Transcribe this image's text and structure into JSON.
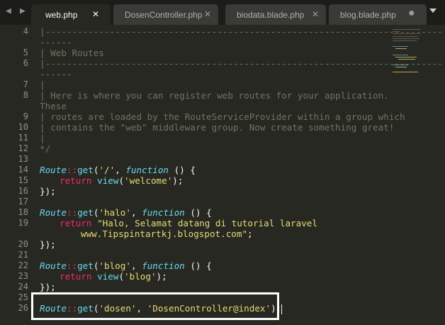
{
  "tabs": [
    {
      "label": "web.php",
      "close": "✕",
      "active": true
    },
    {
      "label": "DosenController.php",
      "close": "✕",
      "active": false
    },
    {
      "label": "biodata.blade.php",
      "close": "✕",
      "active": false
    },
    {
      "label": "blog.blade.php",
      "close": "●",
      "active": false
    }
  ],
  "nav": {
    "left": "◀",
    "right": "▶"
  },
  "line_numbers": [
    "4",
    "",
    "5",
    "6",
    "",
    "7",
    "8",
    "",
    "9",
    "10",
    "11",
    "12",
    "13",
    "14",
    "15",
    "16",
    "17",
    "18",
    "19",
    "",
    "20",
    "21",
    "22",
    "23",
    "24",
    "25",
    "26"
  ],
  "code": {
    "l4": "|--------------------------------------------------------------------------",
    "l4b": "------",
    "l5": "| Web Routes",
    "l6": "|--------------------------------------------------------------------------",
    "l6b": "------",
    "l7": "|",
    "l8": "| Here is where you can register web routes for your application.",
    "l8b": "These",
    "l9": "| routes are loaded by the RouteServiceProvider within a group which",
    "l10": "| contains the \"web\" middleware group. Now create something great!",
    "l11": "|",
    "l12": "*/",
    "route": "Route",
    "dc": "::",
    "get": "get",
    "function": "function",
    "return": "return",
    "view": "view",
    "s_root": "'/'",
    "s_welcome": "'welcome'",
    "s_halo": "'halo'",
    "s_halo_msg": "\"Halo, Selamat datang di tutorial laravel",
    "s_halo_msg2": "www.Tipspintartkj.blogspot.com\"",
    "s_blog": "'blog'",
    "s_blog2": "'blog'",
    "s_dosen": "'dosen'",
    "s_ctrl": "'DosenController@index'",
    "open": "(",
    "comma": ", ",
    "fn_tail": " () {",
    "close_paren": ")",
    "semi": ";",
    "end": "});",
    "end_stmt": ");"
  }
}
